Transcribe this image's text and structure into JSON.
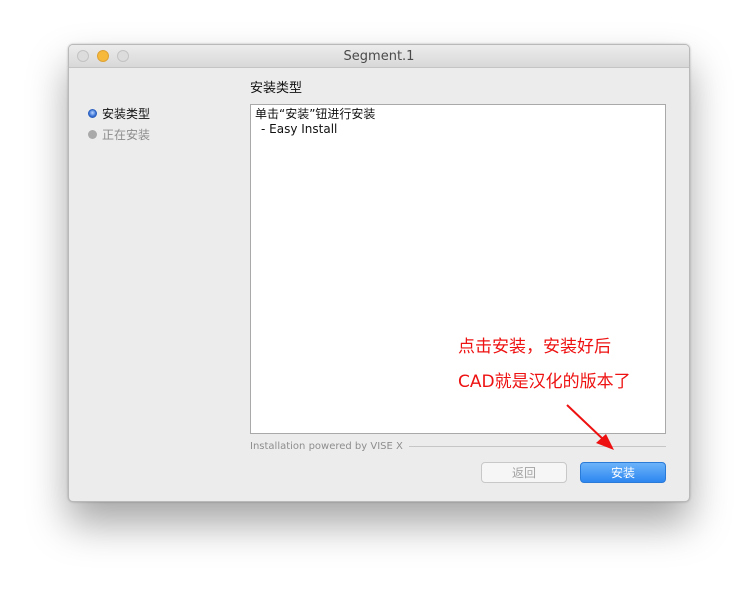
{
  "window": {
    "title": "Segment.1"
  },
  "sidebar": {
    "steps": [
      {
        "label": "安装类型"
      },
      {
        "label": "正在安装"
      }
    ]
  },
  "main": {
    "heading": "安装类型",
    "textbox": {
      "line1": "单击“安装”钮进行安装",
      "line2": "- Easy Install"
    },
    "powered_by": "Installation powered by VISE X"
  },
  "buttons": {
    "back_label": "返回",
    "install_label": "安装"
  },
  "annotation": {
    "line1": "点击安装，安装好后",
    "line2": "CAD就是汉化的版本了",
    "color": "#ee1111"
  }
}
